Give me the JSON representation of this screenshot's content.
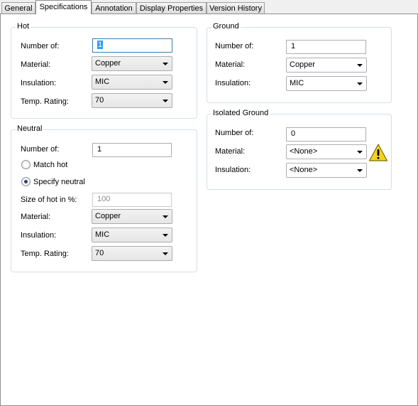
{
  "tabs": [
    "General",
    "Specifications",
    "Annotation",
    "Display Properties",
    "Version History"
  ],
  "active_tab": "Specifications",
  "hot": {
    "title": "Hot",
    "number_label": "Number of:",
    "number_value": "1",
    "material_label": "Material:",
    "material_value": "Copper",
    "insulation_label": "Insulation:",
    "insulation_value": "MIC",
    "temp_label": "Temp. Rating:",
    "temp_value": "70"
  },
  "neutral": {
    "title": "Neutral",
    "number_label": "Number of:",
    "number_value": "1",
    "match_hot_label": "Match hot",
    "specify_neutral_label": "Specify neutral",
    "selected_option": "Specify neutral",
    "size_label": "Size of hot in %:",
    "size_value": "100",
    "material_label": "Material:",
    "material_value": "Copper",
    "insulation_label": "Insulation:",
    "insulation_value": "MIC",
    "temp_label": "Temp. Rating:",
    "temp_value": "70"
  },
  "ground": {
    "title": "Ground",
    "number_label": "Number of:",
    "number_value": "1",
    "material_label": "Material:",
    "material_value": "Copper",
    "insulation_label": "Insulation:",
    "insulation_value": "MIC"
  },
  "isolated_ground": {
    "title": "Isolated Ground",
    "number_label": "Number of:",
    "number_value": "0",
    "material_label": "Material:",
    "material_value": "<None>",
    "insulation_label": "Insulation:",
    "insulation_value": "<None>",
    "warning_icon": "warning-icon"
  },
  "colors": {
    "selection": "#3399ff",
    "warning": "#f5d222"
  }
}
